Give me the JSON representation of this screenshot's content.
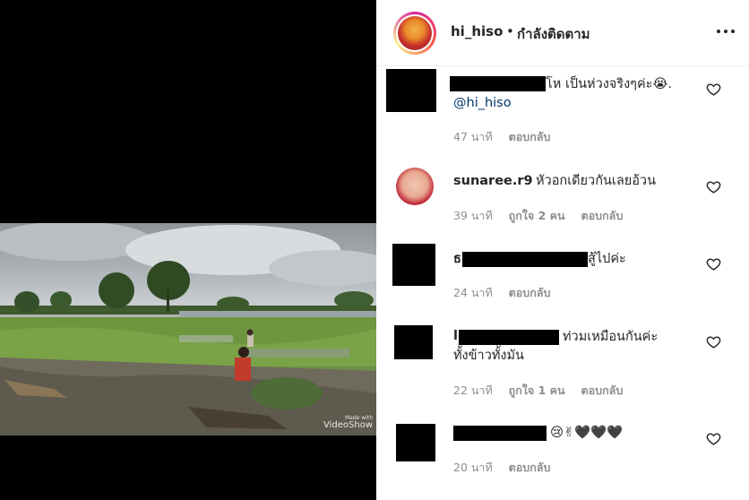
{
  "media": {
    "watermark_made": "Made with",
    "watermark_brand": "VideoShow"
  },
  "header": {
    "username": "hi_hiso",
    "separator": "•",
    "follow_status": "กำลังติดตาม",
    "more_icon": "more-horizontal-icon"
  },
  "comments": [
    {
      "text": "โห เป็นห่วงจริงๆค่ะ😭.",
      "mention": "@hi_hiso",
      "time": "47 นาที",
      "likes": "",
      "reply": "ตอบกลับ"
    },
    {
      "username": "sunaree.r9",
      "text": "หัวอกเดียวกันเลยอ้วน",
      "time": "39 นาที",
      "likes": "ถูกใจ 2 คน",
      "reply": "ตอบกลับ"
    },
    {
      "username_fragment": "ธ",
      "text": "สู้ไปค่ะ",
      "time": "24 นาที",
      "likes": "",
      "reply": "ตอบกลับ"
    },
    {
      "username_fragment": "l",
      "text_line1": "ท่วมเหมือนกันค่ะ",
      "text_line2": "ทั้งข้าวทั้งมัน",
      "time": "22 นาที",
      "likes": "ถูกใจ 1 คน",
      "reply": "ตอบกลับ"
    },
    {
      "text": "😢✌🖤🖤🖤",
      "time": "20 นาที",
      "likes": "",
      "reply": "ตอบกลับ"
    }
  ]
}
